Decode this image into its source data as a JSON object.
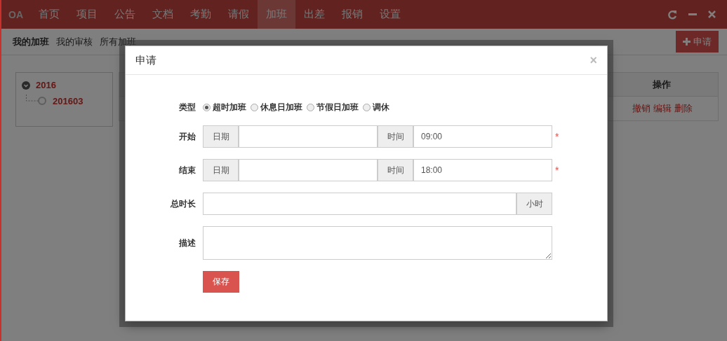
{
  "topbar": {
    "logo": "OA",
    "nav": [
      {
        "label": "首页",
        "selected": false
      },
      {
        "label": "项目",
        "selected": false
      },
      {
        "label": "公告",
        "selected": false
      },
      {
        "label": "文档",
        "selected": false
      },
      {
        "label": "考勤",
        "selected": false
      },
      {
        "label": "请假",
        "selected": false
      },
      {
        "label": "加班",
        "selected": true
      },
      {
        "label": "出差",
        "selected": false
      },
      {
        "label": "报销",
        "selected": false
      },
      {
        "label": "设置",
        "selected": false
      }
    ]
  },
  "subnav": {
    "tabs": [
      {
        "label": "我的加班",
        "selected": true
      },
      {
        "label": "我的审核",
        "selected": false
      },
      {
        "label": "所有加班",
        "selected": false
      }
    ],
    "apply_button": "申请"
  },
  "tree": [
    {
      "label": "2016",
      "expanded": true,
      "children": [
        {
          "label": "201603"
        }
      ]
    }
  ],
  "table": {
    "action_header": "操作",
    "rows": [
      {
        "actions": [
          "撤销",
          "编辑",
          "删除"
        ]
      }
    ]
  },
  "modal": {
    "title": "申请",
    "close": "×",
    "type": {
      "label": "类型",
      "options": [
        {
          "label": "超时加班",
          "selected": true
        },
        {
          "label": "休息日加班",
          "selected": false
        },
        {
          "label": "节假日加班",
          "selected": false
        },
        {
          "label": "调休",
          "selected": false
        }
      ]
    },
    "start": {
      "label": "开始",
      "date_addon": "日期",
      "time_addon": "时间",
      "time": "09:00",
      "required": "*"
    },
    "end": {
      "label": "结束",
      "date_addon": "日期",
      "time_addon": "时间",
      "time": "18:00",
      "required": "*"
    },
    "duration": {
      "label": "总时长",
      "unit": "小时"
    },
    "description": {
      "label": "描述"
    },
    "save": "保存"
  }
}
